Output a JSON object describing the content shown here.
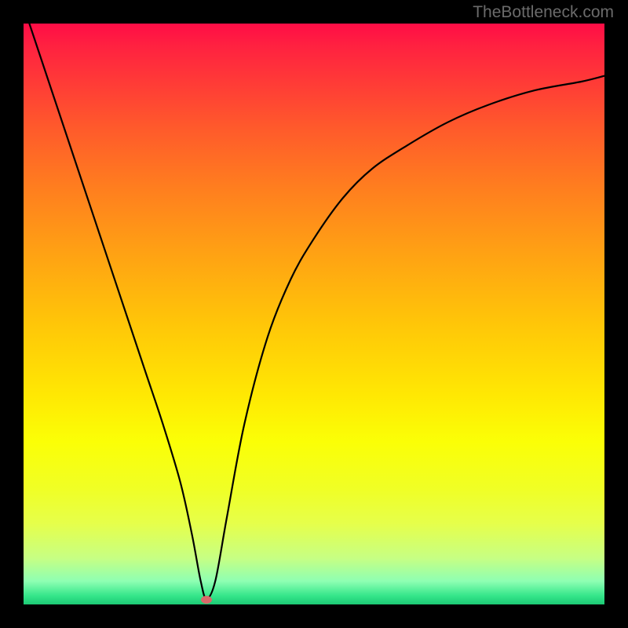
{
  "watermark": "TheBottleneck.com",
  "chart_data": {
    "type": "line",
    "title": "",
    "xlabel": "",
    "ylabel": "",
    "xlim": [
      0,
      100
    ],
    "ylim": [
      0,
      100
    ],
    "series": [
      {
        "name": "curve",
        "x": [
          1,
          3,
          6,
          9,
          12,
          15,
          18,
          21,
          24,
          27,
          29,
          30.5,
          31.5,
          33,
          35,
          38,
          42,
          46,
          50,
          55,
          60,
          66,
          73,
          80,
          88,
          96,
          100
        ],
        "y": [
          100,
          94,
          85,
          76,
          67,
          58,
          49,
          40,
          31,
          21,
          12,
          4,
          1,
          4,
          15,
          31,
          46,
          56,
          63,
          70,
          75,
          79,
          83,
          86,
          88.5,
          90,
          91
        ]
      }
    ],
    "marker": {
      "x": 31.5,
      "y": 0.8
    },
    "gradient_stops": [
      {
        "pos": 0.0,
        "color": "#ff0d46"
      },
      {
        "pos": 0.5,
        "color": "#ffc708"
      },
      {
        "pos": 0.85,
        "color": "#f0ff25"
      },
      {
        "pos": 1.0,
        "color": "#1cc974"
      }
    ],
    "grid": false
  }
}
